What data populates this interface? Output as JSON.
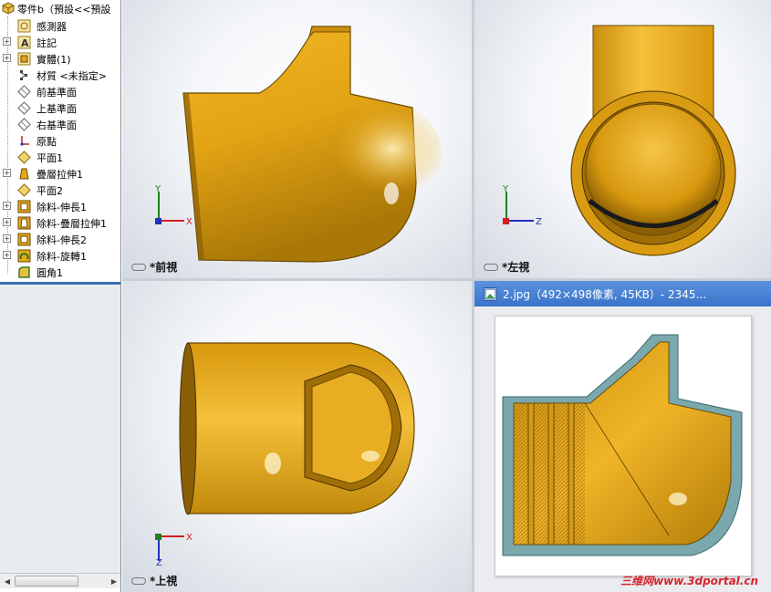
{
  "tree": {
    "root_label": "零件b（預設<<預設",
    "items": [
      {
        "label": "感測器",
        "icon": "sensor-icon",
        "expand": false
      },
      {
        "label": "註記",
        "icon": "annotation-icon",
        "expand": true
      },
      {
        "label": "實體(1)",
        "icon": "solid-bodies-icon",
        "expand": true
      },
      {
        "label": "材質 <未指定>",
        "icon": "material-icon",
        "expand": false
      },
      {
        "label": "前基準面",
        "icon": "plane-icon",
        "expand": false
      },
      {
        "label": "上基準面",
        "icon": "plane-icon",
        "expand": false
      },
      {
        "label": "右基準面",
        "icon": "plane-icon",
        "expand": false
      },
      {
        "label": "原點",
        "icon": "origin-icon",
        "expand": false
      },
      {
        "label": "平面1",
        "icon": "plane-feature-icon",
        "expand": false
      },
      {
        "label": "疊層拉伸1",
        "icon": "loft-icon",
        "expand": true
      },
      {
        "label": "平面2",
        "icon": "plane-feature-icon",
        "expand": false
      },
      {
        "label": "除料-伸長1",
        "icon": "cut-extrude-icon",
        "expand": true
      },
      {
        "label": "除料-疊層拉伸1",
        "icon": "cut-loft-icon",
        "expand": true
      },
      {
        "label": "除料-伸長2",
        "icon": "cut-extrude-icon",
        "expand": true
      },
      {
        "label": "除料-旋轉1",
        "icon": "cut-revolve-icon",
        "expand": true
      },
      {
        "label": "圓角1",
        "icon": "fillet-icon",
        "expand": false
      }
    ]
  },
  "viewports": {
    "front": {
      "label": "*前視",
      "axis_a": "Y",
      "axis_b": "X"
    },
    "left": {
      "label": "*左視",
      "axis_a": "Y",
      "axis_b": "Z"
    },
    "top": {
      "label": "*上視",
      "axis_a": "Z",
      "axis_b": "X"
    }
  },
  "viewer": {
    "title": "2.jpg（492×498像素, 45KB）- 2345...",
    "watermark": "三维网www.3dportal.cn"
  },
  "colors": {
    "part_gold": "#e8a817",
    "part_shadow": "#9a6a05",
    "section_teal": "#7aa8ac",
    "title_blue": "#3a73c9",
    "axis_x": "#d02020",
    "axis_y": "#208020",
    "axis_z": "#2030c0"
  }
}
